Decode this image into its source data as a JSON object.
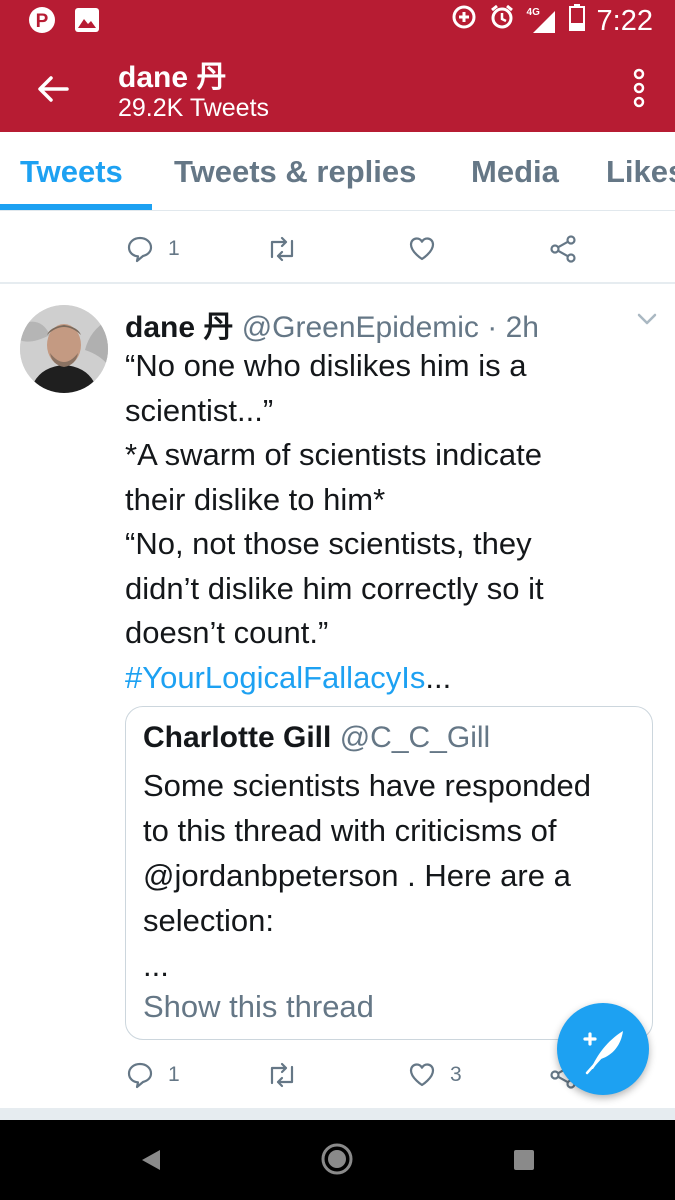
{
  "status_bar": {
    "network": "4G",
    "time": "7:22"
  },
  "header": {
    "name": "dane 丹",
    "tweet_count": "29.2K Tweets"
  },
  "tabs": [
    {
      "label": "Tweets",
      "active": true
    },
    {
      "label": "Tweets & replies",
      "active": false
    },
    {
      "label": "Media",
      "active": false
    },
    {
      "label": "Likes",
      "active": false
    }
  ],
  "previous_tweet": {
    "reply_count": "1"
  },
  "tweet": {
    "name": "dane 丹",
    "handle": "@GreenEpidemic",
    "time": "· 2h",
    "lines": [
      "“No one who dislikes him is a",
      "scientist...”",
      "*A swarm of scientists indicate",
      "their dislike to him*",
      "“No, not those scientists, they",
      "didn’t dislike him correctly so it",
      "doesn’t count.”"
    ],
    "hashtag": "#YourLogicalFallacyIs",
    "ellipsis": "...",
    "quoted": {
      "name": "Charlotte Gill",
      "handle": "@C_C_Gill",
      "lines": [
        "Some scientists have responded",
        "to this thread with criticisms of",
        "@jordanbpeterson . Here are a",
        "selection:",
        "..."
      ],
      "link": "Show this thread"
    },
    "reply_count": "1",
    "like_count": "3"
  },
  "colors": {
    "brand_red": "#b71c33",
    "accent_blue": "#1da1f2",
    "muted_gray": "#657786"
  }
}
